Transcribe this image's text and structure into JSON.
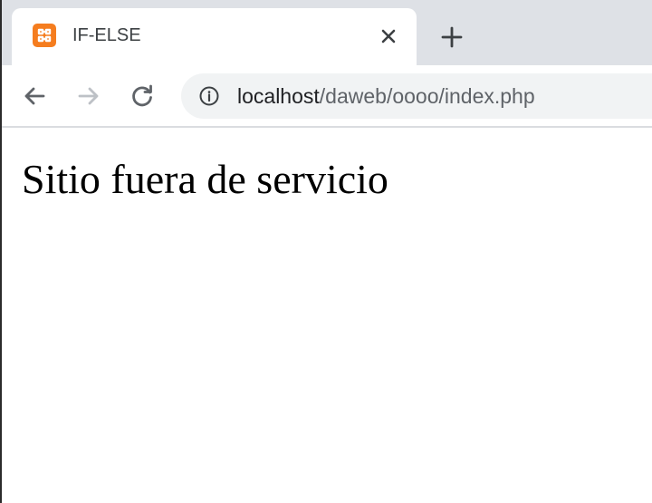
{
  "browser": {
    "tab": {
      "title": "IF-ELSE",
      "favicon": "xampp-logo-icon",
      "favicon_color": "#f57d1f"
    },
    "toolbar": {
      "back_icon": "back-arrow-icon",
      "forward_icon": "forward-arrow-icon",
      "reload_icon": "reload-icon",
      "site_info_icon": "info-icon"
    },
    "address_bar": {
      "host": "localhost",
      "path": "/daweb/oooo/index.php"
    },
    "colors": {
      "tabstrip": "#dee1e6",
      "omnibox": "#f1f3f4",
      "icon_dark": "#5f6368",
      "icon_disabled": "#bdc1c6"
    }
  },
  "page": {
    "message": "Sitio fuera de servicio"
  }
}
